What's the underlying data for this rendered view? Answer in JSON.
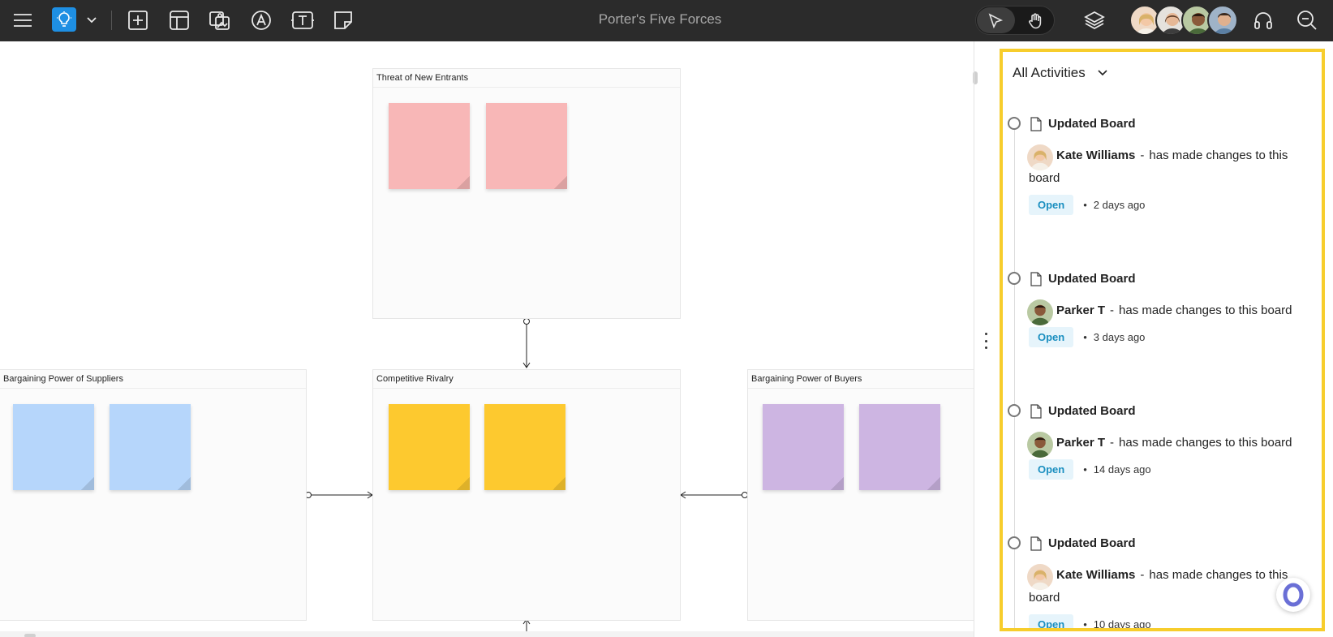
{
  "topbar": {
    "board_title": "Porter's Five Forces",
    "icons": [
      "menu-icon",
      "bulb-icon",
      "chevron-down-icon",
      "add-icon",
      "template-icon",
      "image-icon",
      "pen-icon",
      "text-icon",
      "sticky-note-icon"
    ],
    "right_icons": [
      "pointer-icon",
      "hand-icon",
      "layers-icon",
      "headset-icon",
      "zoom-out-icon"
    ],
    "accent_color": "#1e8fe3"
  },
  "canvas": {
    "frames": [
      {
        "title": "Threat of New Entrants"
      },
      {
        "title": "Bargaining Power of Suppliers"
      },
      {
        "title": "Competitive Rivalry"
      },
      {
        "title": "Bargaining Power of Buyers"
      }
    ],
    "note_colors": {
      "pink": "#f8b7b7",
      "blue": "#b6d6fb",
      "yellow": "#fdc92f",
      "purple": "#cdb5e2"
    }
  },
  "panel": {
    "filter_label": "All Activities",
    "border_color": "#f7cd2c",
    "activities": [
      {
        "title": "Updated Board",
        "user": "Kate Williams",
        "separator": "-",
        "message": "has made changes to this board",
        "status": "Open",
        "bullet": "•",
        "time": "2 days ago"
      },
      {
        "title": "Updated Board",
        "user": "Parker T",
        "separator": "-",
        "message": "has made changes to this board",
        "status": "Open",
        "bullet": "•",
        "time": "3 days ago"
      },
      {
        "title": "Updated Board",
        "user": "Parker T",
        "separator": "-",
        "message": "has made changes to this board",
        "status": "Open",
        "bullet": "•",
        "time": "14 days ago"
      },
      {
        "title": "Updated Board",
        "user": "Kate Williams",
        "separator": "-",
        "message": "has made changes to this board",
        "status": "Open",
        "bullet": "•",
        "time": "10 days ago"
      }
    ]
  }
}
